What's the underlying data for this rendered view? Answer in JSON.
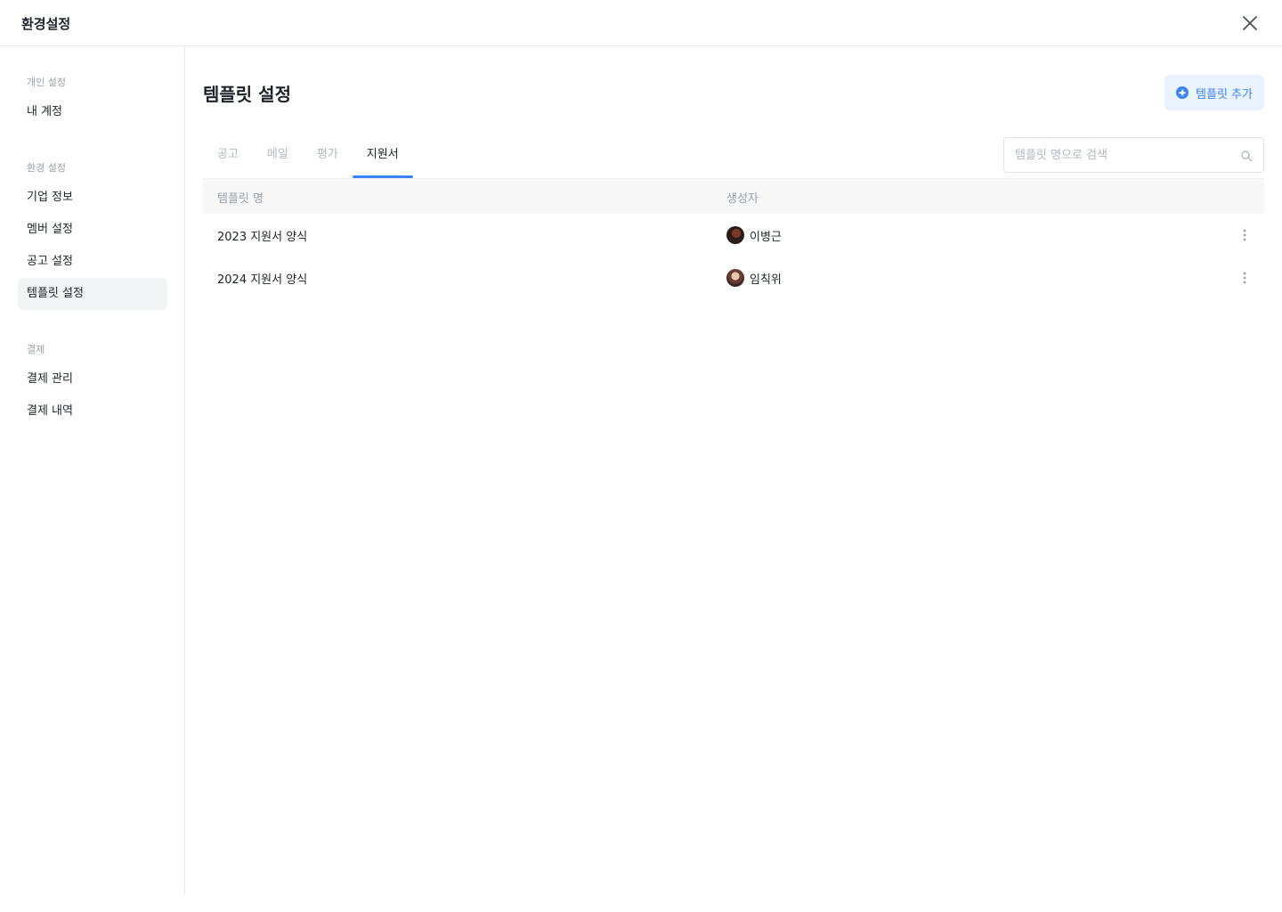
{
  "header": {
    "title": "환경설정"
  },
  "sidebar": {
    "groups": [
      {
        "label": "개인 설정",
        "items": [
          {
            "label": "내 계정"
          }
        ]
      },
      {
        "label": "환경 설정",
        "items": [
          {
            "label": "기업 정보"
          },
          {
            "label": "멤버 설정"
          },
          {
            "label": "공고 설정"
          },
          {
            "label": "템플릿 설정",
            "active": true
          }
        ]
      },
      {
        "label": "결제",
        "items": [
          {
            "label": "결제 관리"
          },
          {
            "label": "결제 내역"
          }
        ]
      }
    ]
  },
  "main": {
    "title": "템플릿 설정",
    "add_button_label": "템플릿 추가",
    "tabs": [
      {
        "label": "공고"
      },
      {
        "label": "메일"
      },
      {
        "label": "평가"
      },
      {
        "label": "지원서",
        "active": true
      }
    ],
    "search": {
      "placeholder": "템플릿 명으로 검색",
      "value": ""
    },
    "table": {
      "columns": [
        "템플릿 명",
        "생성자"
      ],
      "rows": [
        {
          "name": "2023 지원서 양식",
          "creator": "이병근",
          "avatar": "avatar-icon"
        },
        {
          "name": "2024 지원서 양식",
          "creator": "임칙위",
          "avatar": "avatar-icon"
        }
      ]
    }
  },
  "colors": {
    "accent": "#3b82f6",
    "accent_bg": "#eaf2fd",
    "border": "#e6e8eb"
  },
  "icons": {
    "close": "close-icon",
    "search": "search-icon",
    "add": "plus-circle-icon",
    "more": "more-vertical-icon"
  }
}
